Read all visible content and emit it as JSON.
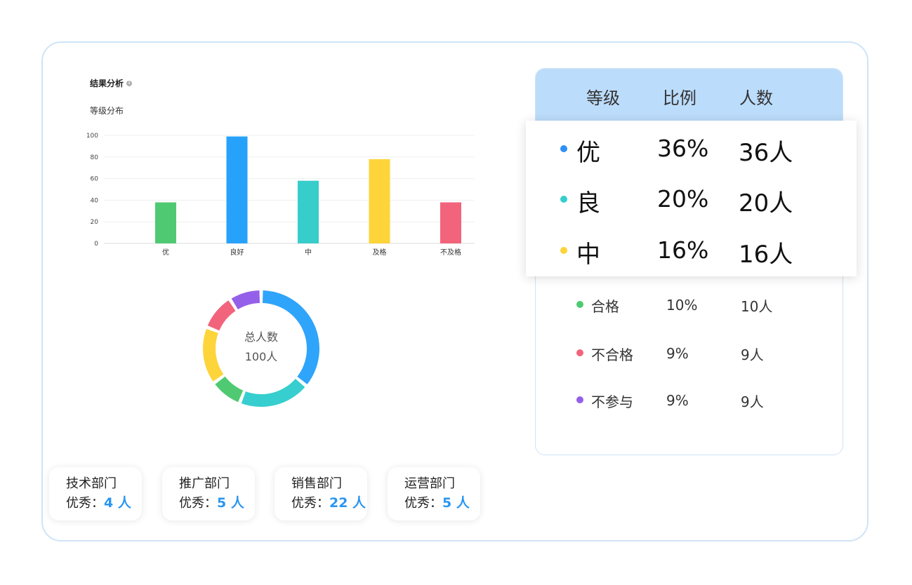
{
  "section": {
    "title": "结果分析",
    "subtitle": "等级分布"
  },
  "chart_data": [
    {
      "type": "bar",
      "title": "等级分布",
      "categories": [
        "优",
        "良好",
        "中",
        "及格",
        "不及格"
      ],
      "values": [
        38,
        99,
        58,
        78,
        38
      ],
      "colors": [
        "#4fca72",
        "#27a2fb",
        "#37cdcb",
        "#fdd43a",
        "#f2647c"
      ],
      "yticks": [
        0,
        20,
        40,
        60,
        80,
        100
      ],
      "ylim": [
        0,
        100
      ],
      "grid": true
    },
    {
      "type": "pie",
      "center_label": "总人数",
      "center_value": "100人",
      "slices": [
        {
          "value": 36,
          "color": "#2fa4fb"
        },
        {
          "value": 20,
          "color": "#36cece"
        },
        {
          "value": 9,
          "color": "#4fca72"
        },
        {
          "value": 16,
          "color": "#fdd43a"
        },
        {
          "value": 10,
          "color": "#f2647c"
        },
        {
          "value": 9,
          "color": "#9560e9"
        }
      ]
    }
  ],
  "table": {
    "headers": {
      "level": "等级",
      "ratio": "比例",
      "count": "人数"
    },
    "highlight_rows": [
      {
        "name": "优",
        "pct": "36%",
        "count": "36人",
        "color": "#2f8ff6"
      },
      {
        "name": "良",
        "pct": "20%",
        "count": "20人",
        "color": "#36cece"
      },
      {
        "name": "中",
        "pct": "16%",
        "count": "16人",
        "color": "#fdd43a"
      }
    ],
    "rows": [
      {
        "name": "合格",
        "pct": "10%",
        "count": "10人",
        "color": "#4fca72"
      },
      {
        "name": "不合格",
        "pct": "9%",
        "count": "9人",
        "color": "#f2647c"
      },
      {
        "name": "不参与",
        "pct": "9%",
        "count": "9人",
        "color": "#9560e9"
      }
    ]
  },
  "departments": [
    {
      "name": "技术部门",
      "label": "优秀：",
      "count": "4 人"
    },
    {
      "name": "推广部门",
      "label": "优秀：",
      "count": "5 人"
    },
    {
      "name": "销售部门",
      "label": "优秀：",
      "count": "22 人"
    },
    {
      "name": "运营部门",
      "label": "优秀：",
      "count": "5 人"
    }
  ]
}
